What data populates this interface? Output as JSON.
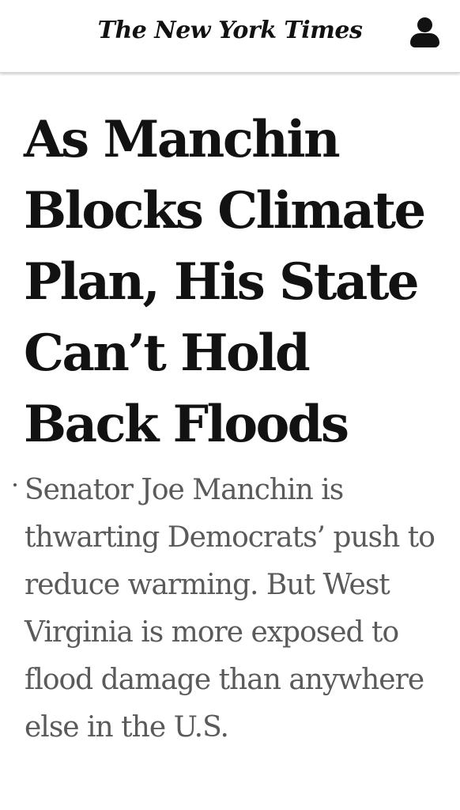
{
  "header": {
    "masthead": "The New York Times",
    "account_icon": "user-icon"
  },
  "article": {
    "headline": "As Manchin Blocks Climate Plan, His State Can’t Hold Back Floods",
    "summary": "Senator Joe Manchin is thwarting Democrats’ push to reduce warming. But West Virginia is more exposed to flood damage than anywhere else in the U.S."
  },
  "colors": {
    "text_primary": "#121212",
    "text_summary": "#5a5a5a",
    "background": "#ffffff"
  }
}
